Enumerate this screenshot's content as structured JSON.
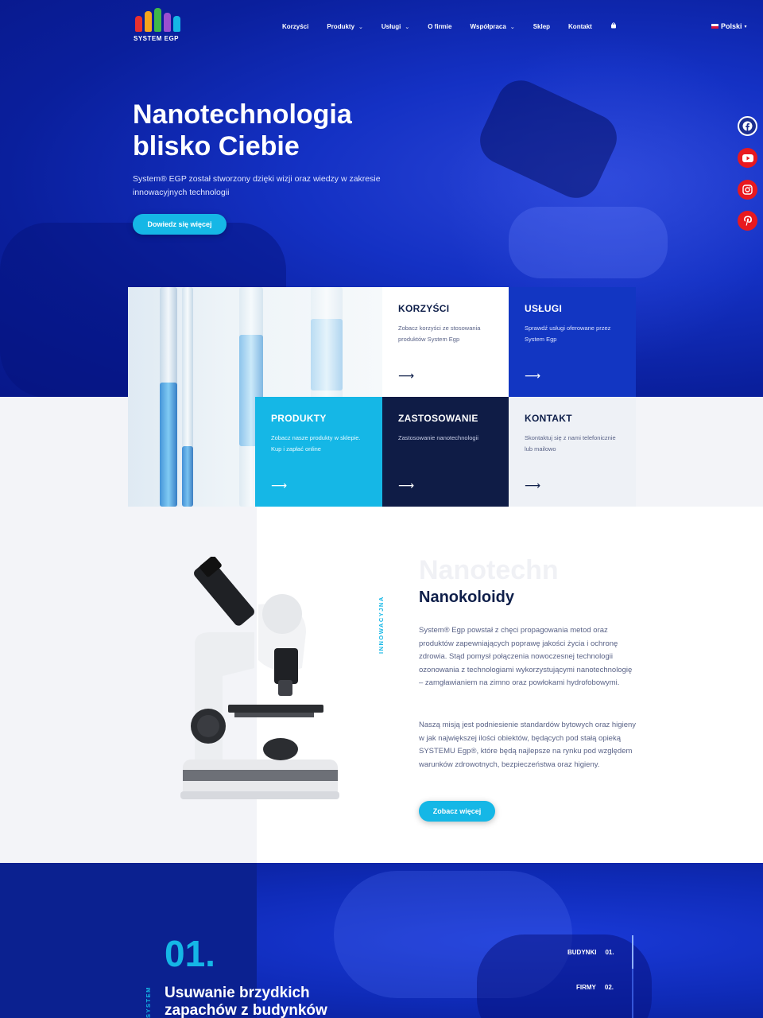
{
  "colors": {
    "brand_blue": "#0a1f9c",
    "accent": "#15b7e6",
    "navy": "#0f1f4a",
    "tile_dark": "#0f1c46"
  },
  "logo": {
    "text": "SYSTEM EGP"
  },
  "nav": {
    "items": [
      {
        "label": "Korzyści",
        "dropdown": false
      },
      {
        "label": "Produkty",
        "dropdown": true
      },
      {
        "label": "Usługi",
        "dropdown": true
      },
      {
        "label": "O firmie",
        "dropdown": false
      },
      {
        "label": "Współpraca",
        "dropdown": true
      },
      {
        "label": "Sklep",
        "dropdown": false
      },
      {
        "label": "Kontakt",
        "dropdown": false
      }
    ],
    "cart_icon": "bag-icon",
    "language": "Polski"
  },
  "hero": {
    "title_line1": "Nanotechnologia",
    "title_line2": "blisko Ciebie",
    "subtitle": "System® EGP został stworzony dzięki wizji oraz wiedzy w zakresie innowacyjnych technologii",
    "cta": "Dowiedz się więcej"
  },
  "social": [
    {
      "name": "facebook-icon",
      "glyph": "f"
    },
    {
      "name": "youtube-icon",
      "glyph": "▶"
    },
    {
      "name": "instagram-icon",
      "glyph": "◎"
    },
    {
      "name": "pinterest-icon",
      "glyph": "P"
    }
  ],
  "tiles": {
    "korzysci": {
      "title": "KORZYŚCI",
      "text": "Zobacz korzyści ze stosowania produktów System Egp",
      "arrow": "⟶"
    },
    "uslugi": {
      "title": "USŁUGI",
      "text": "Sprawdź usługi oferowane przez System Egp",
      "arrow": "⟶"
    },
    "produkty": {
      "title": "PRODUKTY",
      "text": "Zobacz nasze produkty w sklepie. Kup i zapłać online",
      "arrow": "⟶"
    },
    "zastosowanie": {
      "title": "ZASTOSOWANIE",
      "text": "Zastosowanie nanotechnologii",
      "arrow": "⟶"
    },
    "kontakt": {
      "title": "KONTAKT",
      "text": "Skontaktuj się z nami telefonicznie lub mailowo",
      "arrow": "⟶"
    }
  },
  "about": {
    "vertical_label": "INNOWACYJNA",
    "ghost_text": "Nanotechn",
    "title": "Nanokoloidy",
    "paragraph1": "System® Egp powstał z chęci propagowania metod oraz produktów zapewniających poprawę jakości życia i ochronę zdrowia. Stąd pomysł połączenia nowoczesnej technologii ozonowania z technologiami wykorzystującymi nanotechnologię – zamgławianiem na zimno oraz powłokami hydrofobowymi.",
    "paragraph2": "Naszą misją jest podniesienie standardów bytowych oraz higieny w jak największej ilości obiektów, będących pod stałą opieką SYSTEMU Egp®, które będą najlepsze na rynku pod względem warunków zdrowotnych, bezpieczeństwa oraz higieny.",
    "cta": "Zobacz więcej"
  },
  "feature": {
    "number": "01.",
    "vertical_label": "SYSTEM",
    "title": "Usuwanie brzydkich zapachów z budynków",
    "side_links": [
      {
        "label": "BUDYNKI",
        "num": "01."
      },
      {
        "label": "FIRMY",
        "num": "02."
      }
    ]
  }
}
